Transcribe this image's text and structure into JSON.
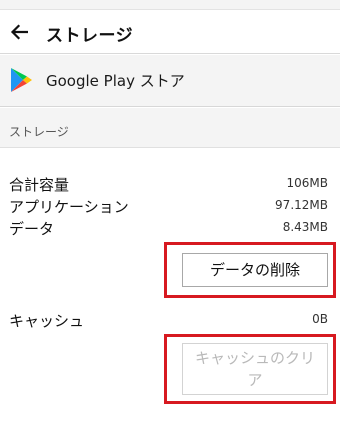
{
  "colors": {
    "highlight": "#d71920",
    "background": "#ffffff",
    "header_background": "#f4f4f4",
    "disabled_text": "#b9b9b9"
  },
  "toolbar": {
    "back_icon": "arrow-left-icon",
    "title": "ストレージ"
  },
  "app": {
    "icon": "google-play-store-icon",
    "name": "Google Play ストア"
  },
  "section": {
    "title": "ストレージ"
  },
  "storage": {
    "rows": [
      {
        "label": "合計容量",
        "value": "106MB"
      },
      {
        "label": "アプリケーション",
        "value": "97.12MB"
      },
      {
        "label": "データ",
        "value": "8.43MB"
      }
    ],
    "clear_data_button": "データの削除",
    "cache_label": "キャッシュ",
    "cache_value": "0B",
    "clear_cache_button": "キャッシュのクリア",
    "clear_cache_enabled": false
  }
}
